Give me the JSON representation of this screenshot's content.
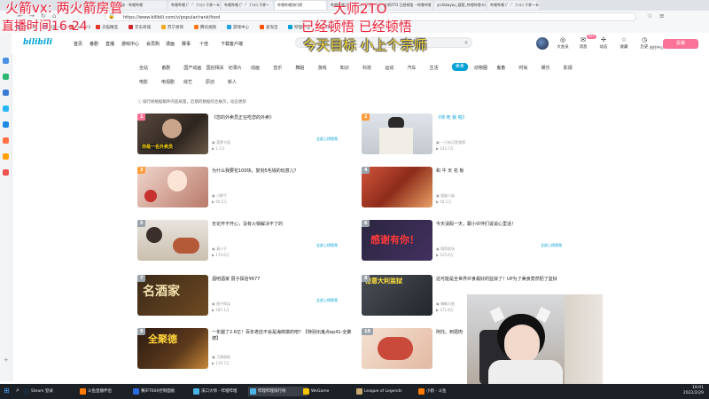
{
  "overlay": {
    "line1": "火箭vx: 两火箭房管",
    "line2": "直播时间16-24",
    "line3": "大师2TO",
    "line4": "已经顿悟 已经顿悟",
    "line5": "今天目标 小上个宗师"
  },
  "browser": {
    "tabs": [
      "动态 - 哔哩哔哩",
      "哔哩哔哩 (゜-゜)つロ 干杯~-bilibili",
      "哔哩哔哩 (゜-゜)つロ 干杯~",
      "哔哩哔哩排行榜",
      "哔哩哔哩 (゜-゜)つロ 干杯~-bilibili",
      "大师2TO 已经顿悟 - 哔哩哔哩",
      "yichibayou_搜索_哔哩哔哩-bilibili",
      "哔哩哔哩 (゜-゜)つロ 干杯~-bilibili"
    ],
    "url": "https://www.bilibili.com/v/popular/rank/food",
    "search_hint": "火箭vx 两火箭房管 大师2TO"
  },
  "bookmarks": [
    "网址导航",
    "百度一下",
    "hao123",
    "天猫精选",
    "京东商城",
    "苏宁易购",
    "腾讯视频",
    "游戏中心",
    "爱淘宝",
    "哔哩哔哩",
    "拼多多"
  ],
  "header": {
    "logo": "bilibili",
    "nav": [
      "首页",
      "番剧",
      "直播",
      "游戏中心",
      "会员购",
      "漫画",
      "赛事",
      "十佳",
      "下载客户端"
    ],
    "right_nav": [
      "大会员",
      "消息",
      "动态",
      "收藏",
      "历史",
      "创作中心"
    ],
    "msg_badge": "99+",
    "upload": "投稿"
  },
  "categories_row1": [
    "全站",
    "番剧",
    "国产动画",
    "国创相关",
    "纪录片",
    "动画",
    "音乐",
    "舞蹈",
    "游戏",
    "知识",
    "科技",
    "运动",
    "汽车",
    "生活",
    "美食",
    "动物圈",
    "鬼畜",
    "时尚",
    "娱乐",
    "影视"
  ],
  "categories_row2": [
    "电影",
    "电视剧",
    "综艺",
    "原创",
    "新人"
  ],
  "selected_category": "美食",
  "hint": "排行榜根据稿件内容质量，近期的数据综合展示，动态更新",
  "items": [
    {
      "rank": "1",
      "title": "《您的外卖员正在吃您的外卖》",
      "up": "菠萝大厨",
      "views": "1.2万",
      "more": "全部上榜视频",
      "thumb_text": "你是一名外卖员"
    },
    {
      "rank": "2",
      "title": "《帅 死 我 啦》",
      "up": "一只赤贝是我啊",
      "views": "143.7万",
      "more": "",
      "thumb_text": ""
    },
    {
      "rank": "3",
      "title": "为什么我要花100块，复刻5毛钱的玩意儿？",
      "up": "小野子",
      "views": "40.2万",
      "more": "",
      "thumb_text": ""
    },
    {
      "rank": "4",
      "title": "和 牛 天 花 板",
      "up": "超级小桀",
      "views": "54.1万",
      "more": "",
      "thumb_text": ""
    },
    {
      "rank": "5",
      "title": "无论开不开心，没有火锅解决不了的",
      "up": "真小子",
      "views": "170.6万",
      "more": "全部上榜视频",
      "thumb_text": ""
    },
    {
      "rank": "6",
      "title": "今天请假一天，跟小伙伴们说说心里话！",
      "up": "翔哥农场",
      "views": "125.6万",
      "more": "全部上榜视频",
      "thumb_text": "感谢有你！"
    },
    {
      "rank": "7",
      "title": "酒吧酒家 厨子探店¥677",
      "up": "厨子探店",
      "views": "181.1万",
      "more": "全部上榜视频",
      "thumb_text": "名酒家"
    },
    {
      "rank": "8",
      "title": "这可能是全世界伙食最好的监狱了！UP为了美食竟然把了监狱",
      "up": "蜘蛛大厨",
      "views": "271.8万",
      "more": "",
      "thumb_text": "秘意大利监狱"
    },
    {
      "rank": "9",
      "title": "一年腿了2.6亿！百年老店不会是海鲜做的吧？【特别出鬼点ep41-全聚德】",
      "up": "王刚做饭",
      "views": "110.7万",
      "more": "",
      "thumb_text": "全聚德"
    },
    {
      "rank": "10",
      "title": "阿托。到把肉",
      "up": "",
      "views": "",
      "more": "",
      "thumb_text": ""
    }
  ],
  "taskbar": {
    "items": [
      "Steam 登录",
      "斗鱼直播伴侣",
      "赛声T600控制面板",
      "溪口大师 - 哔哩哔哩",
      "哔哩哔哩排行榜",
      "WeGame",
      "League of Legends",
      "小鹤 - 斗鱼"
    ],
    "time": "19:01",
    "date": "2022/2/29"
  },
  "colors": {
    "accent": "#00a1d6",
    "pink": "#fb7299",
    "overlay_red": "#e8213a",
    "overlay_yellow": "#f2d93a"
  }
}
